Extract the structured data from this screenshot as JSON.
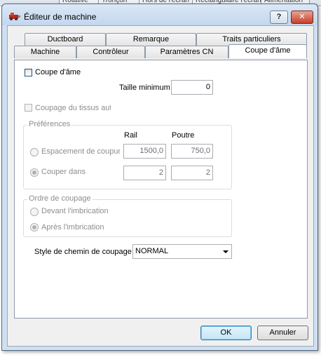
{
  "background": {
    "tabs": [
      "Rotative",
      "Tronçon",
      "Hors de l'écran",
      "Rectangulaire l'écran",
      "Alimentation"
    ]
  },
  "window": {
    "title": "Éditeur de machine",
    "help_label": "?",
    "close_label": "✕"
  },
  "tabs_back": [
    "Ductboard",
    "Remarque",
    "Traits particuliers"
  ],
  "tabs_front": [
    "Machine",
    "Contrôleur",
    "Paramètres CN",
    "Coupe d'âme"
  ],
  "panel": {
    "coupe_ame_checkbox": "Coupe d'âme",
    "taille_min_label": "Taille minimum",
    "taille_min_value": "0",
    "coupage_tissus_checkbox": "Coupage du tissus auto",
    "preferences": {
      "title": "Préférences",
      "col_rail": "Rail",
      "col_poutre": "Poutre",
      "row1_label": "Espacement de coupure",
      "row1_rail": "1500,0",
      "row1_poutre": "750,0",
      "row2_label": "Couper dans",
      "row2_rail": "2",
      "row2_poutre": "2",
      "selected_row": "Couper dans"
    },
    "ordre": {
      "title": "Ordre de coupage",
      "option1": "Devant l'imbrication",
      "option2": "Après l'imbrication",
      "selected": "Après l'imbrication"
    },
    "style_label": "Style de chemin de coupage",
    "style_value": "NORMAL"
  },
  "buttons": {
    "ok": "OK",
    "cancel": "Annuler"
  },
  "colors": {
    "title_bar": "#c3d7ee",
    "close_button": "#c7402a",
    "default_button": "#c4e5f6"
  }
}
